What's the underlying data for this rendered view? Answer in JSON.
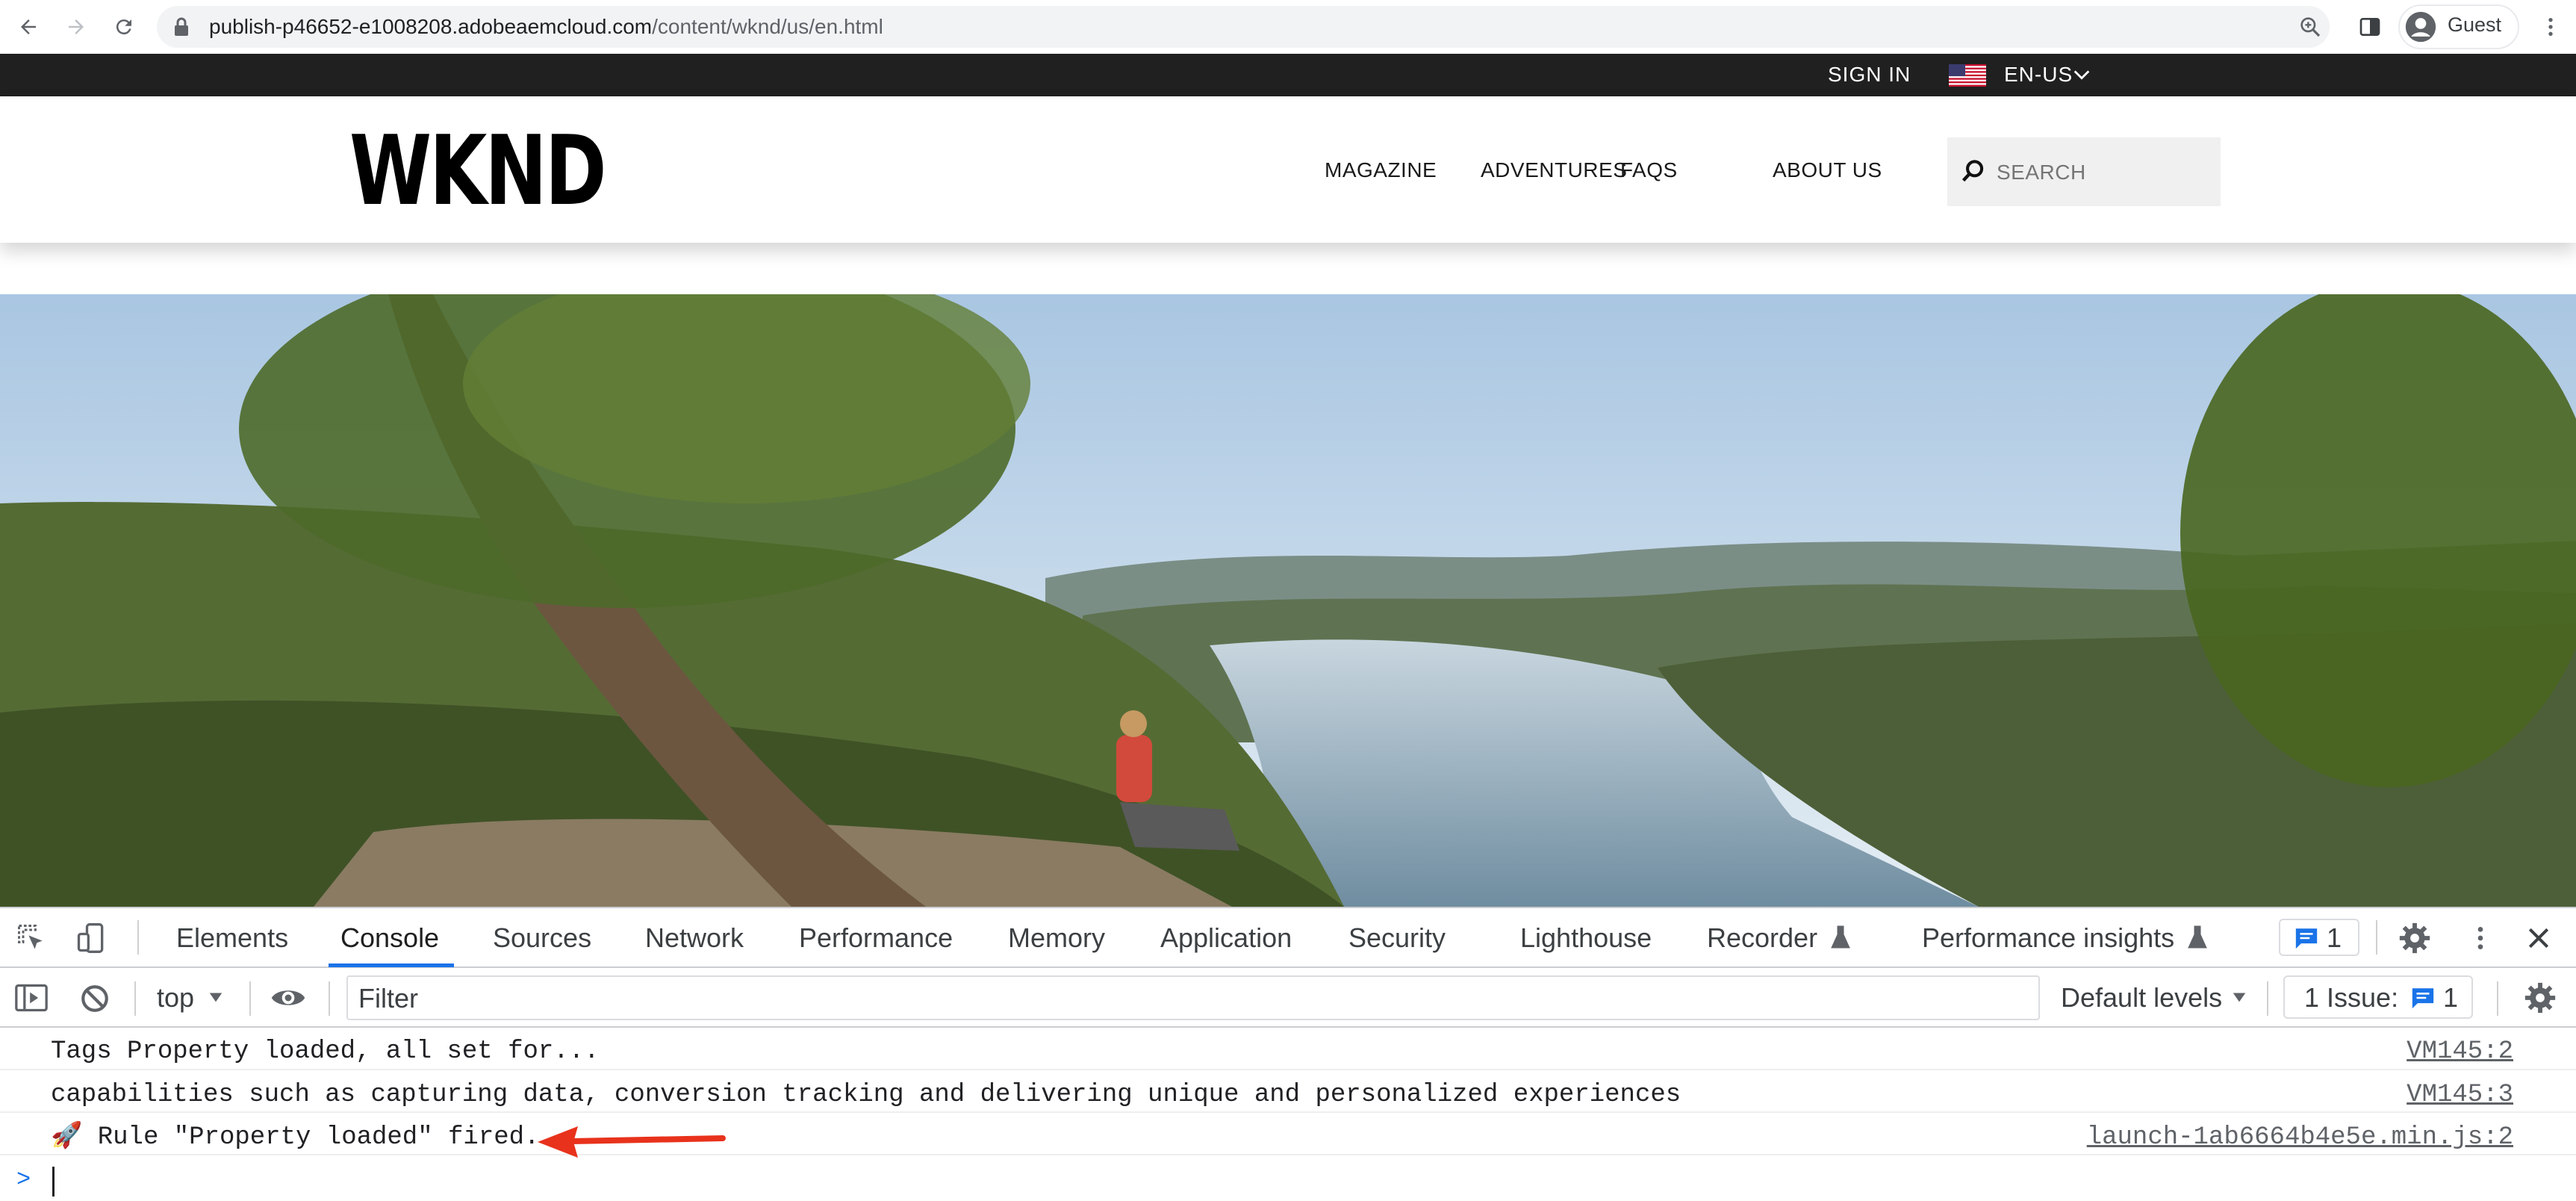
{
  "browser": {
    "url_host": "publish-p46652-e1008208.adobeaemcloud.com",
    "url_path": "/content/wknd/us/en.html",
    "profile_label": "Guest"
  },
  "site": {
    "topbar": {
      "signin": "SIGN IN",
      "locale": "EN-US"
    },
    "logo": "WKND",
    "nav": [
      "MAGAZINE",
      "ADVENTURES",
      "FAQS",
      "ABOUT US"
    ],
    "search_placeholder": "SEARCH"
  },
  "devtools": {
    "tabs": [
      "Elements",
      "Console",
      "Sources",
      "Network",
      "Performance",
      "Memory",
      "Application",
      "Security",
      "Lighthouse",
      "Recorder",
      "Performance insights"
    ],
    "active_tab": "Console",
    "issues_badge_count": "1",
    "toolbar": {
      "context": "top",
      "filter_placeholder": "Filter",
      "levels": "Default levels",
      "issues_label": "1 Issue:",
      "issues_count": "1"
    },
    "console_lines": [
      {
        "text": "Tags Property loaded, all set for...",
        "source": "VM145:2"
      },
      {
        "text": "capabilities such as capturing data, conversion tracking and delivering unique and personalized experiences",
        "source": "VM145:3"
      },
      {
        "text": "🚀 Rule \"Property loaded\" fired.",
        "source": "launch-1ab6664b4e5e.min.js:2"
      }
    ],
    "prompt_symbol": ">"
  },
  "colors": {
    "accent_blue": "#1a73e8",
    "annotation_arrow": "#e8321c",
    "topbar_bg": "#202020"
  }
}
